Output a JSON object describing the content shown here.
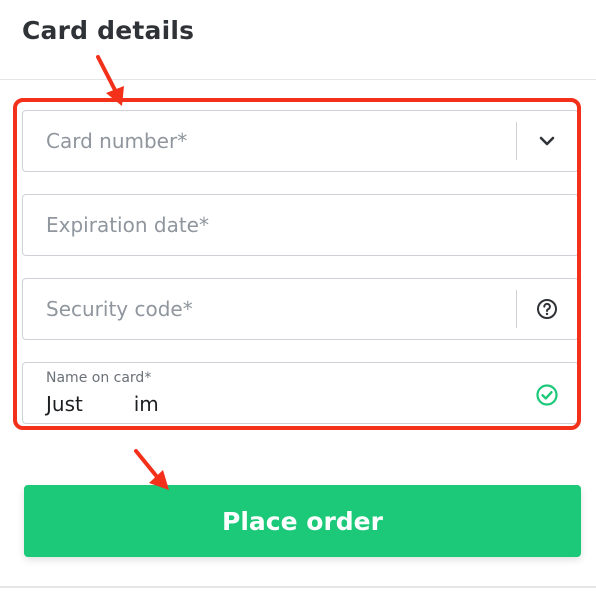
{
  "header": {
    "title": "Card details"
  },
  "form": {
    "card_number": {
      "placeholder": "Card number*",
      "trailing_icon": "chevron-down-icon"
    },
    "expiration_date": {
      "placeholder": "Expiration date*"
    },
    "security_code": {
      "placeholder": "Security code*",
      "trailing_icon": "help-circle-icon"
    },
    "name_on_card": {
      "label": "Name on card*",
      "value": "Just        im",
      "trailing_icon": "check-circle-icon"
    }
  },
  "actions": {
    "place_order_label": "Place order"
  },
  "colors": {
    "title_text": "#2f3337",
    "field_border": "#ced2d7",
    "placeholder_text": "#8f969e",
    "valid_check": "#1bc978",
    "primary_button": "#1bc978",
    "annotation_red": "#f3301a"
  }
}
